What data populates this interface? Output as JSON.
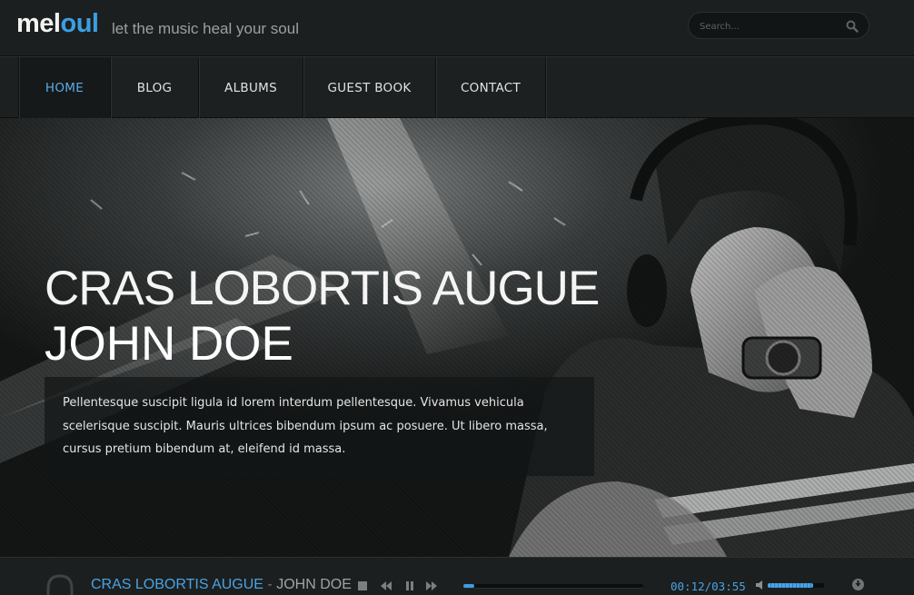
{
  "brand": {
    "logo_part1": "mel",
    "logo_part2": "oul",
    "tagline": "let the music heal your soul"
  },
  "search": {
    "placeholder": "Search..."
  },
  "nav": {
    "items": [
      {
        "label": "HOME",
        "active": true
      },
      {
        "label": "BLOG",
        "active": false
      },
      {
        "label": "ALBUMS",
        "active": false
      },
      {
        "label": "GUEST BOOK",
        "active": false
      },
      {
        "label": "CONTACT",
        "active": false
      }
    ]
  },
  "hero": {
    "title_line1": "CRAS LOBORTIS AUGUE",
    "title_line2": "JOHN DOE",
    "text": "Pellentesque suscipit ligula id lorem interdum pellentesque. Vivamus vehicula scelerisque suscipit. Mauris ultrices bibendum ipsum ac posuere. Ut libero massa, cursus pretium bibendum at, eleifend id massa."
  },
  "player": {
    "track_title": "CRAS LOBORTIS AUGUE",
    "separator": " - ",
    "artist": "JOHN DOE",
    "time": "00:12/03:55",
    "progress_fraction": 0.06,
    "volume_fraction": 0.8,
    "icons": [
      "headphones-icon",
      "stop-icon",
      "rewind-icon",
      "pause-icon",
      "fast-forward-icon",
      "volume-icon",
      "download-icon"
    ]
  },
  "colors": {
    "accent": "#3b9fe0",
    "background": "#1c1f1f"
  }
}
